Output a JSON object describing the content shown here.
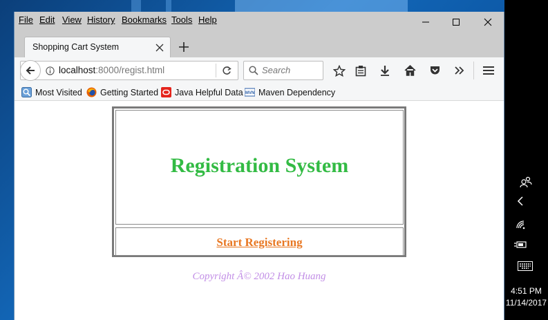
{
  "menu": {
    "file": "File",
    "edit": "Edit",
    "view": "View",
    "history": "History",
    "bookmarks": "Bookmarks",
    "tools": "Tools",
    "help": "Help"
  },
  "tab": {
    "title": "Shopping Cart System"
  },
  "url": {
    "host": "localhost",
    "rest": ":8000/regist.html"
  },
  "search": {
    "placeholder": "Search"
  },
  "bookmarks": [
    {
      "label": "Most Visited",
      "icon": "most-visited-icon"
    },
    {
      "label": "Getting Started",
      "icon": "firefox-icon"
    },
    {
      "label": "Java Helpful Data",
      "icon": "oracle-icon"
    },
    {
      "label": "Maven Dependency",
      "icon": "maven-icon"
    }
  ],
  "page": {
    "heading": "Registration System",
    "start_link": "Start Registering",
    "copyright": "Copyright Â© 2002 Hao Huang"
  },
  "clock": {
    "time": "4:51 PM",
    "date": "11/14/2017"
  },
  "colors": {
    "heading": "#33bb44",
    "link": "#e87722",
    "copyright": "#c28ee6",
    "chrome": "#cccccc"
  }
}
